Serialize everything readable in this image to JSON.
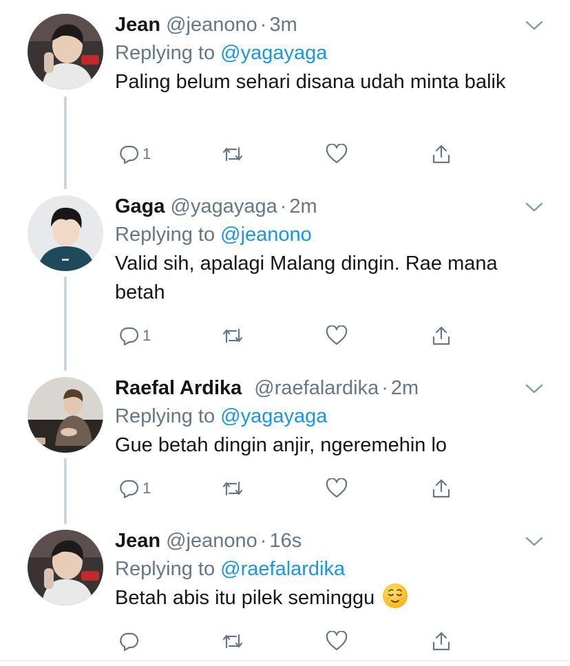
{
  "tweets": [
    {
      "name": "Jean",
      "handle": "@jeanono",
      "dot": "·",
      "time": "3m",
      "replying_prefix": "Replying to",
      "replying_to": "@yagayaga",
      "text": "Paling belum sehari disana udah minta balik",
      "reply_count": "1"
    },
    {
      "name": "Gaga",
      "handle": "@yagayaga",
      "dot": "·",
      "time": "2m",
      "replying_prefix": "Replying to",
      "replying_to": "@jeanono",
      "text": "Valid sih, apalagi Malang dingin. Rae mana betah",
      "reply_count": "1"
    },
    {
      "name": "Raefal Ardika",
      "handle": "@raefalardika",
      "dot": "·",
      "time": "2m",
      "replying_prefix": "Replying to",
      "replying_to": "@yagayaga",
      "text": "Gue betah dingin anjir, ngeremehin lo",
      "reply_count": "1"
    },
    {
      "name": "Jean",
      "handle": "@jeanono",
      "dot": "·",
      "time": "16s",
      "replying_prefix": "Replying to",
      "replying_to": "@raefalardika",
      "text": "Betah abis itu pilek seminggu",
      "emoji": "relieved-face-emoji",
      "reply_count": ""
    }
  ],
  "icons": {
    "reply": "reply-icon",
    "retweet": "retweet-icon",
    "like": "like-icon",
    "share": "share-icon",
    "more": "chevron-down-icon"
  },
  "colors": {
    "link": "#1b95e0",
    "secondary_text": "#657786",
    "thread_line": "#cdd6dd"
  }
}
